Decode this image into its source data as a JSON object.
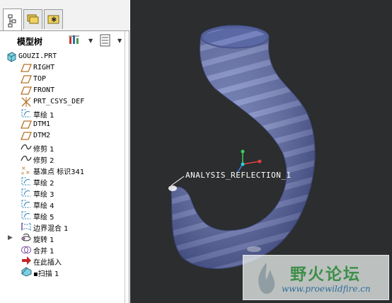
{
  "model_tree": {
    "title": "模型树",
    "items": [
      {
        "label": "GOUZI.PRT",
        "icon": "part-icon",
        "mono": true
      },
      {
        "label": "RIGHT",
        "icon": "datum-plane-icon",
        "mono": true
      },
      {
        "label": "TOP",
        "icon": "datum-plane-icon",
        "mono": true
      },
      {
        "label": "FRONT",
        "icon": "datum-plane-icon",
        "mono": true
      },
      {
        "label": "PRT_CSYS_DEF",
        "icon": "coordinate-system-icon",
        "mono": true
      },
      {
        "label": "草绘 1",
        "icon": "sketch-icon",
        "mono": false
      },
      {
        "label": "DTM1",
        "icon": "datum-plane-icon",
        "mono": true
      },
      {
        "label": "DTM2",
        "icon": "datum-plane-icon",
        "mono": true
      },
      {
        "label": "修剪 1",
        "icon": "trim-curve-icon",
        "mono": false
      },
      {
        "label": "修剪 2",
        "icon": "trim-curve-icon",
        "mono": false
      },
      {
        "label": "基准点 标识341",
        "icon": "datum-point-icon",
        "mono": false
      },
      {
        "label": "草绘 2",
        "icon": "sketch-icon",
        "mono": false
      },
      {
        "label": "草绘 3",
        "icon": "sketch-icon",
        "mono": false
      },
      {
        "label": "草绘 4",
        "icon": "sketch-icon",
        "mono": false
      },
      {
        "label": "草绘 5",
        "icon": "sketch-icon",
        "mono": false
      },
      {
        "label": "边界混合 1",
        "icon": "boundary-blend-icon",
        "mono": false
      },
      {
        "label": "旋转 1",
        "icon": "revolve-icon",
        "mono": false,
        "expandable": true
      },
      {
        "label": "合并 1",
        "icon": "merge-icon",
        "mono": false
      },
      {
        "label": "在此插入",
        "icon": "insert-here-arrow-icon",
        "mono": false
      },
      {
        "label": "▪扫描 1",
        "icon": "sweep-icon",
        "mono": false
      }
    ]
  },
  "viewport": {
    "annotation": "ANALYSIS_REFLECTION_1"
  },
  "watermark": {
    "text": "野火论坛",
    "url": "www.proewildfire.cn"
  },
  "colors": {
    "viewport_bg": "#2b2d2e",
    "model_base": "#5c6aa6",
    "model_stripe": "#7f8cc6",
    "datum_plane": "#b5732a",
    "sketch": "#2a7fb5",
    "watermark_green": "#3f8f4a"
  }
}
